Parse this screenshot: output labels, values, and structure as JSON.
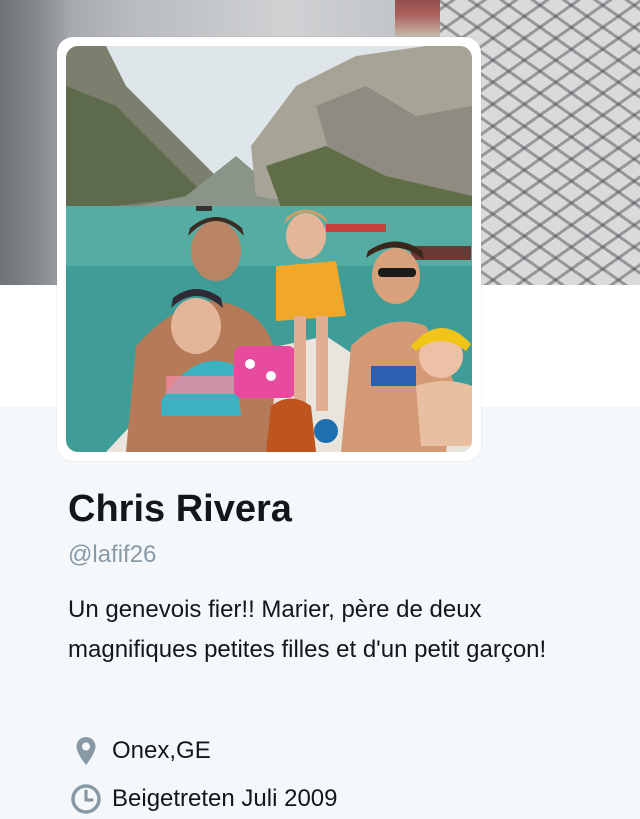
{
  "profile": {
    "name": "Chris Rivera",
    "handle": "@lafif26",
    "bio": "Un genevois fier!! Marier, père de deux magnifiques petites filles et d'un petit garçon!",
    "location": "Onex,GE",
    "joined": "Beigetreten Juli 2009"
  },
  "icons": {
    "location": "map-pin-icon",
    "joined": "calendar-clock-icon"
  },
  "colors": {
    "name_text": "#14171a",
    "handle_text": "#8899a6",
    "icon_gray": "#8899a6",
    "background": "#f5f8fa"
  }
}
